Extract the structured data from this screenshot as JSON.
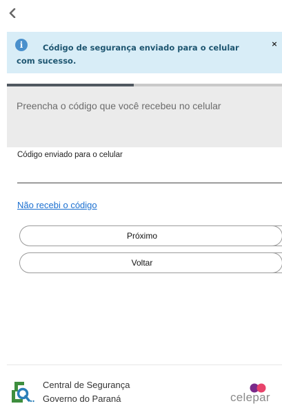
{
  "nav": {
    "back_icon": "chevron-left-icon"
  },
  "alert": {
    "icon": "info-icon",
    "icon_glyph": "i",
    "message": "Código de segurança enviado para o celular com sucesso.",
    "close_glyph": "×",
    "background": "#d8edf7",
    "text_color": "#1d5570"
  },
  "progress": {
    "value": 0.46
  },
  "panel": {
    "instruction": "Preencha o código que você recebeu no celular"
  },
  "form": {
    "code_label": "Código enviado para o celular",
    "code_value": "",
    "resend_link": "Não recebi o código",
    "next_button": "Próximo",
    "back_button": "Voltar"
  },
  "footer": {
    "line1": "Central de Segurança",
    "line2": "Governo do Paraná",
    "partner": "celepar",
    "colors": {
      "green": "#3e8e3e",
      "blue": "#2a7fb8",
      "purple": "#7a2a8a",
      "pink": "#e8436b"
    }
  }
}
